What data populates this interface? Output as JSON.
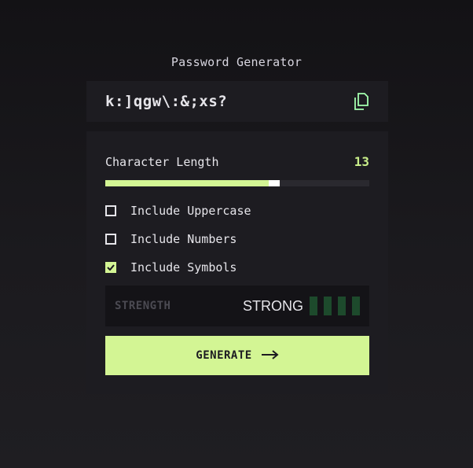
{
  "app": {
    "title": "Password Generator"
  },
  "output": {
    "password": "k:]qgw\\:&;xs?",
    "copy_icon": "copy-icon"
  },
  "length": {
    "label": "Character Length",
    "value": "13",
    "slider_fraction": 0.63
  },
  "options": [
    {
      "label": "Include Uppercase",
      "checked": false
    },
    {
      "label": "Include Numbers",
      "checked": false
    },
    {
      "label": "Include Symbols",
      "checked": true
    }
  ],
  "strength": {
    "label": "STRENGTH",
    "value": "STRONG",
    "bars_filled": 4
  },
  "generate": {
    "label": "GENERATE",
    "icon": "arrow-right-icon"
  },
  "colors": {
    "accent": "#d3f594",
    "strength_bar": "#1d4a2c"
  }
}
